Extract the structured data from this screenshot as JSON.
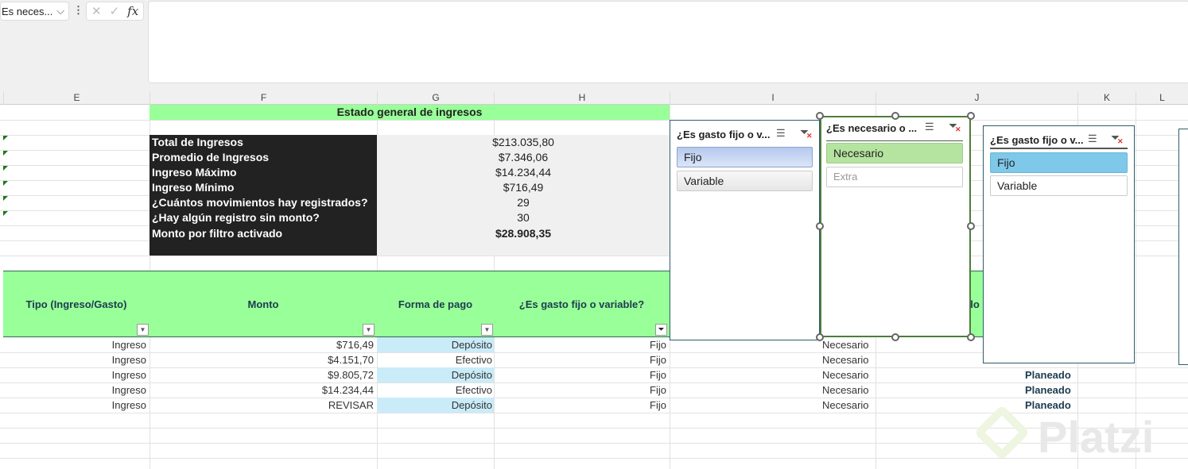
{
  "formula_bar": {
    "name_box": "Es neces...",
    "cancel": "✕",
    "enter": "✓",
    "fx": "fx",
    "formula": ""
  },
  "columns": [
    "E",
    "F",
    "G",
    "H",
    "I",
    "J",
    "K",
    "L"
  ],
  "summary": {
    "title": "Estado general de ingresos",
    "rows": [
      {
        "label": "Total de Ingresos",
        "value": "$213.035,80"
      },
      {
        "label": "Promedio de Ingresos",
        "value": "$7.346,06"
      },
      {
        "label": "Ingreso Máximo",
        "value": "$14.234,44"
      },
      {
        "label": "Ingreso Mínimo",
        "value": "$716,49"
      },
      {
        "label": "¿Cuántos movimientos hay registrados?",
        "value": "29"
      },
      {
        "label": "¿Hay algún registro sin monto?",
        "value": "30"
      },
      {
        "label": "Monto por filtro activado",
        "value": "$28.908,35"
      }
    ]
  },
  "table": {
    "headers": [
      "Tipo (Ingreso/Gasto)",
      "Monto",
      "Forma de pago",
      "¿Es gasto fijo o variable?",
      "lo"
    ],
    "rows": [
      {
        "tipo": "Ingreso",
        "monto": "$716,49",
        "pago": "Depósito",
        "fijo": "Fijo",
        "nec": "Necesario",
        "plan": ""
      },
      {
        "tipo": "Ingreso",
        "monto": "$4.151,70",
        "pago": "Efectivo",
        "fijo": "Fijo",
        "nec": "Necesario",
        "plan": "Planeado"
      },
      {
        "tipo": "Ingreso",
        "monto": "$9.805,72",
        "pago": "Depósito",
        "fijo": "Fijo",
        "nec": "Necesario",
        "plan": "Planeado"
      },
      {
        "tipo": "Ingreso",
        "monto": "$14.234,44",
        "pago": "Efectivo",
        "fijo": "Fijo",
        "nec": "Necesario",
        "plan": "Planeado"
      },
      {
        "tipo": "Ingreso",
        "monto": "REVISAR",
        "pago": "Depósito",
        "fijo": "Fijo",
        "nec": "Necesario",
        "plan": "Planeado"
      }
    ]
  },
  "slicers": [
    {
      "title": "¿Es gasto fijo o v...",
      "items": [
        "Fijo",
        "Variable"
      ]
    },
    {
      "title": "¿Es necesario o ...",
      "items": [
        "Necesario",
        "Extra"
      ]
    },
    {
      "title": "¿Es gasto fijo o v...",
      "items": [
        "Fijo",
        "Variable"
      ]
    }
  ],
  "watermark": "Platzi"
}
